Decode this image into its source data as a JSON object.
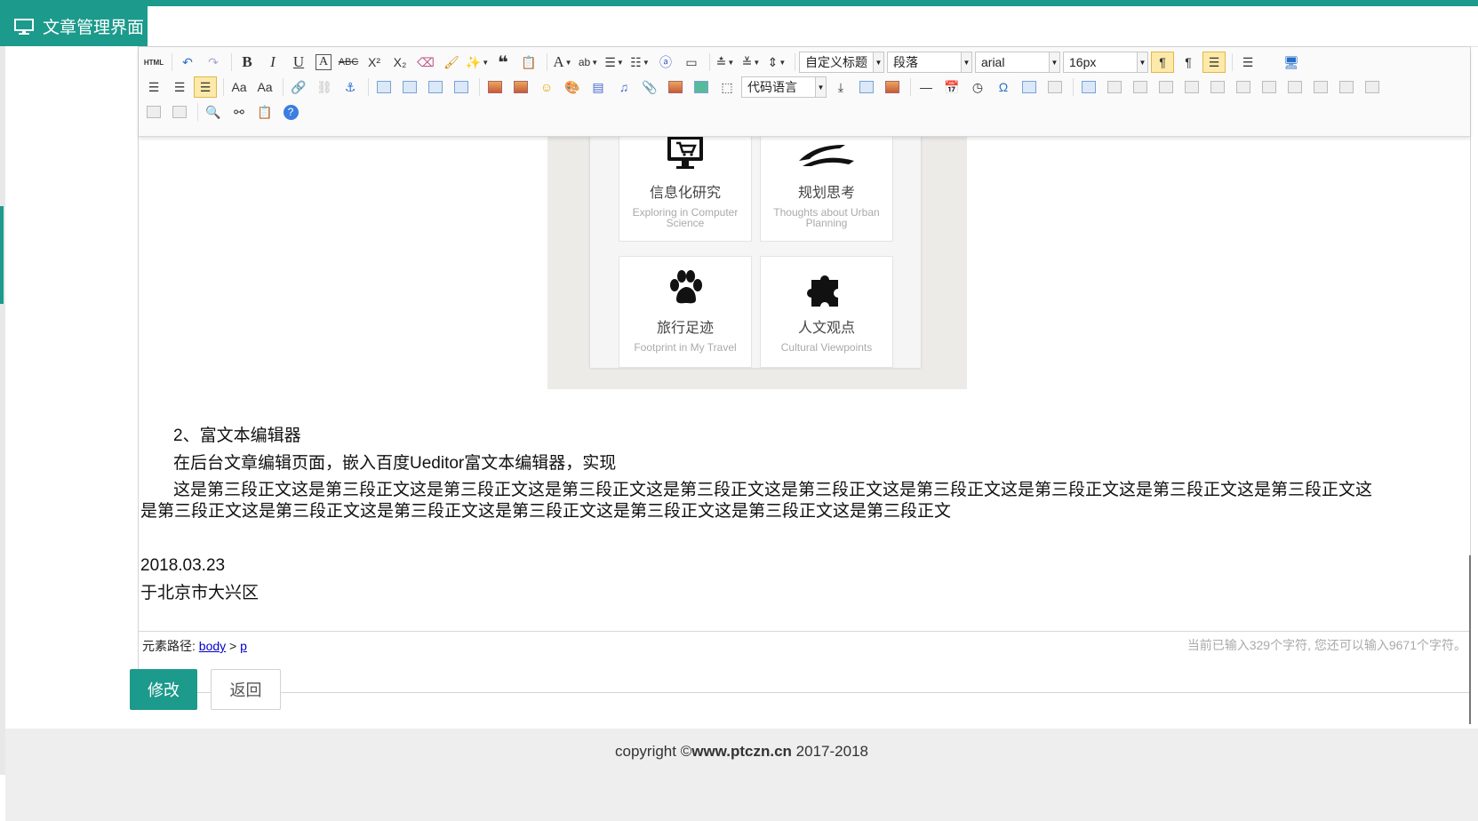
{
  "window": {
    "tab_title": "文章管理界面",
    "tab_icon": "monitor-icon"
  },
  "toolbar": {
    "html_label": "HTML",
    "heading_select": "自定义标题",
    "paragraph_select": "段落",
    "font_select": "arial",
    "size_select": "16px",
    "code_select": "代码语言"
  },
  "content": {
    "card1_title": "信息化研究",
    "card1_sub": "Exploring in Computer Science",
    "card2_title": "规划思考",
    "card2_sub": "Thoughts about Urban Planning",
    "card3_title": "旅行足迹",
    "card3_sub": "Footprint in My Travel",
    "card4_title": "人文观点",
    "card4_sub": "Cultural Viewpoints",
    "heading2": "2、富文本编辑器",
    "para1": "在后台文章编辑页面，嵌入百度Ueditor富文本编辑器，实现",
    "para2_line1": "这是第三段正文这是第三段正文这是第三段正文这是第三段正文这是第三段正文这是第三段正文这是第三段正文这是第三段正文这是第三段正文这是第三段正文这",
    "para2_line2": "是第三段正文这是第三段正文这是第三段正文这是第三段正文这是第三段正文这是第三段正文这是第三段正文",
    "date": "2018.03.23",
    "place": "于北京市大兴区"
  },
  "statusbar": {
    "path_label": "元素路径:",
    "path_body": "body",
    "path_sep": ">",
    "path_p": "p",
    "count_text": "当前已输入329个字符, 您还可以输入9671个字符。"
  },
  "actions": {
    "edit_label": "修改",
    "back_label": "返回"
  },
  "footer": {
    "copyright_prefix": "copyright ©",
    "site": "www.ptczn.cn",
    "years": " 2017-2018"
  },
  "colors": {
    "accent": "#1c9a8c",
    "link": "#0000cc"
  }
}
